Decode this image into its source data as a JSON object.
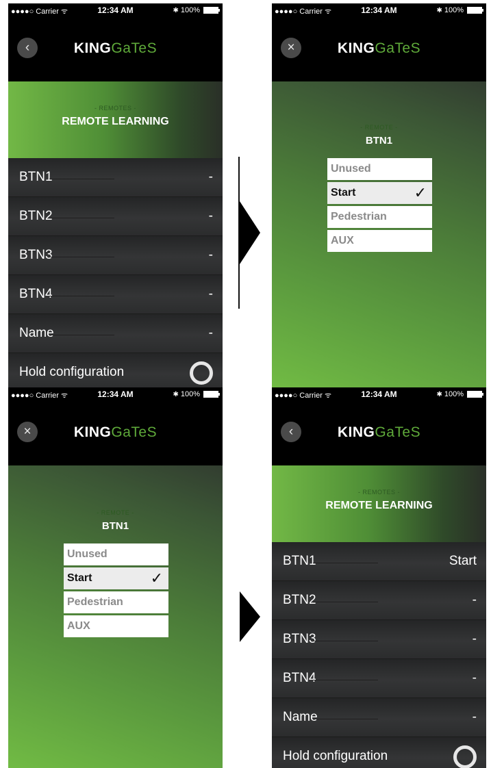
{
  "status": {
    "carrier": "●●●●○ Carrier ᯤ",
    "time": "12:34 AM",
    "battery": "100%",
    "bluetooth": "✱"
  },
  "logo": {
    "bold": "KING",
    "light": "GaTeS"
  },
  "remotes_header": {
    "sub": "- REMOTES -",
    "title": "REMOTE LEARNING"
  },
  "remote_header": {
    "sub": "- REMOTE -",
    "title": "BTN1"
  },
  "options": [
    {
      "label": "Unused",
      "selected": false
    },
    {
      "label": "Start",
      "selected": true
    },
    {
      "label": "Pedestrian",
      "selected": false
    },
    {
      "label": "AUX",
      "selected": false
    }
  ],
  "list_before": [
    {
      "label": "BTN1",
      "value": "-"
    },
    {
      "label": "BTN2",
      "value": "-"
    },
    {
      "label": "BTN3",
      "value": "-"
    },
    {
      "label": "BTN4",
      "value": "-"
    },
    {
      "label": "Name",
      "value": "-"
    },
    {
      "label": "Hold configuration",
      "value": ""
    }
  ],
  "list_after": [
    {
      "label": "BTN1",
      "value": "Start"
    },
    {
      "label": "BTN2",
      "value": "-"
    },
    {
      "label": "BTN3",
      "value": "-"
    },
    {
      "label": "BTN4",
      "value": "-"
    },
    {
      "label": "Name",
      "value": "-"
    },
    {
      "label": "Hold configuration",
      "value": ""
    }
  ],
  "icons": {
    "back": "back-icon",
    "close": "close-icon",
    "check": "checkmark-icon",
    "toggle": "toggle-circle-icon"
  },
  "colors": {
    "brand_green": "#5faa3a",
    "header_dark": "#000000",
    "list_bg": "#2e2f30"
  }
}
